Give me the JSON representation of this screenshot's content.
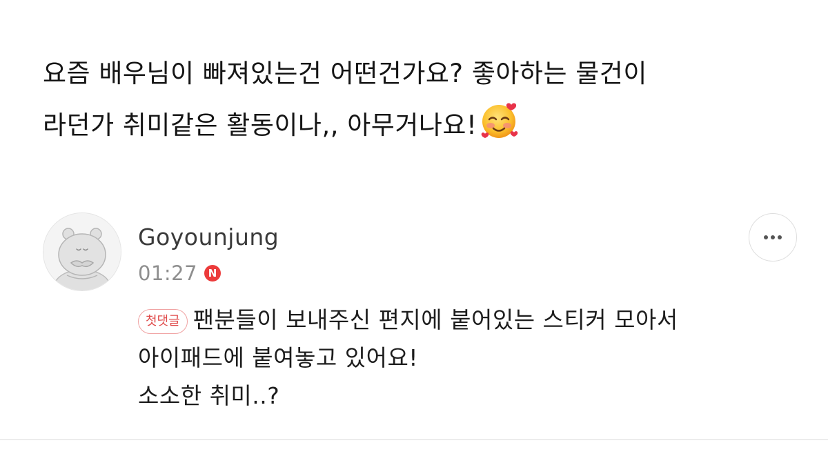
{
  "question": {
    "line1": "요즘 배우님이 빠져있는건 어떤건가요? 좋아하는 물건이",
    "line2": "라던가 취미같은 활동이나,, 아무거나요!",
    "emoji": "smiling-face-with-hearts-icon"
  },
  "comment": {
    "author": "Goyounjung",
    "time": "01:27",
    "new_badge": "N",
    "first_comment_badge": "첫댓글",
    "line1": "팬분들이 보내주신 편지에 붙어있는 스티커 모아서",
    "line2": "아이패드에 붙여놓고 있어요!",
    "line3": "소소한 취미..?",
    "more_icon": "more-horizontal-icon",
    "avatar_icon": "cat-avatar-icon"
  },
  "colors": {
    "accent_red": "#ec3b3b",
    "badge_border": "#f0a3a3",
    "muted_text": "#8e8e8e"
  }
}
